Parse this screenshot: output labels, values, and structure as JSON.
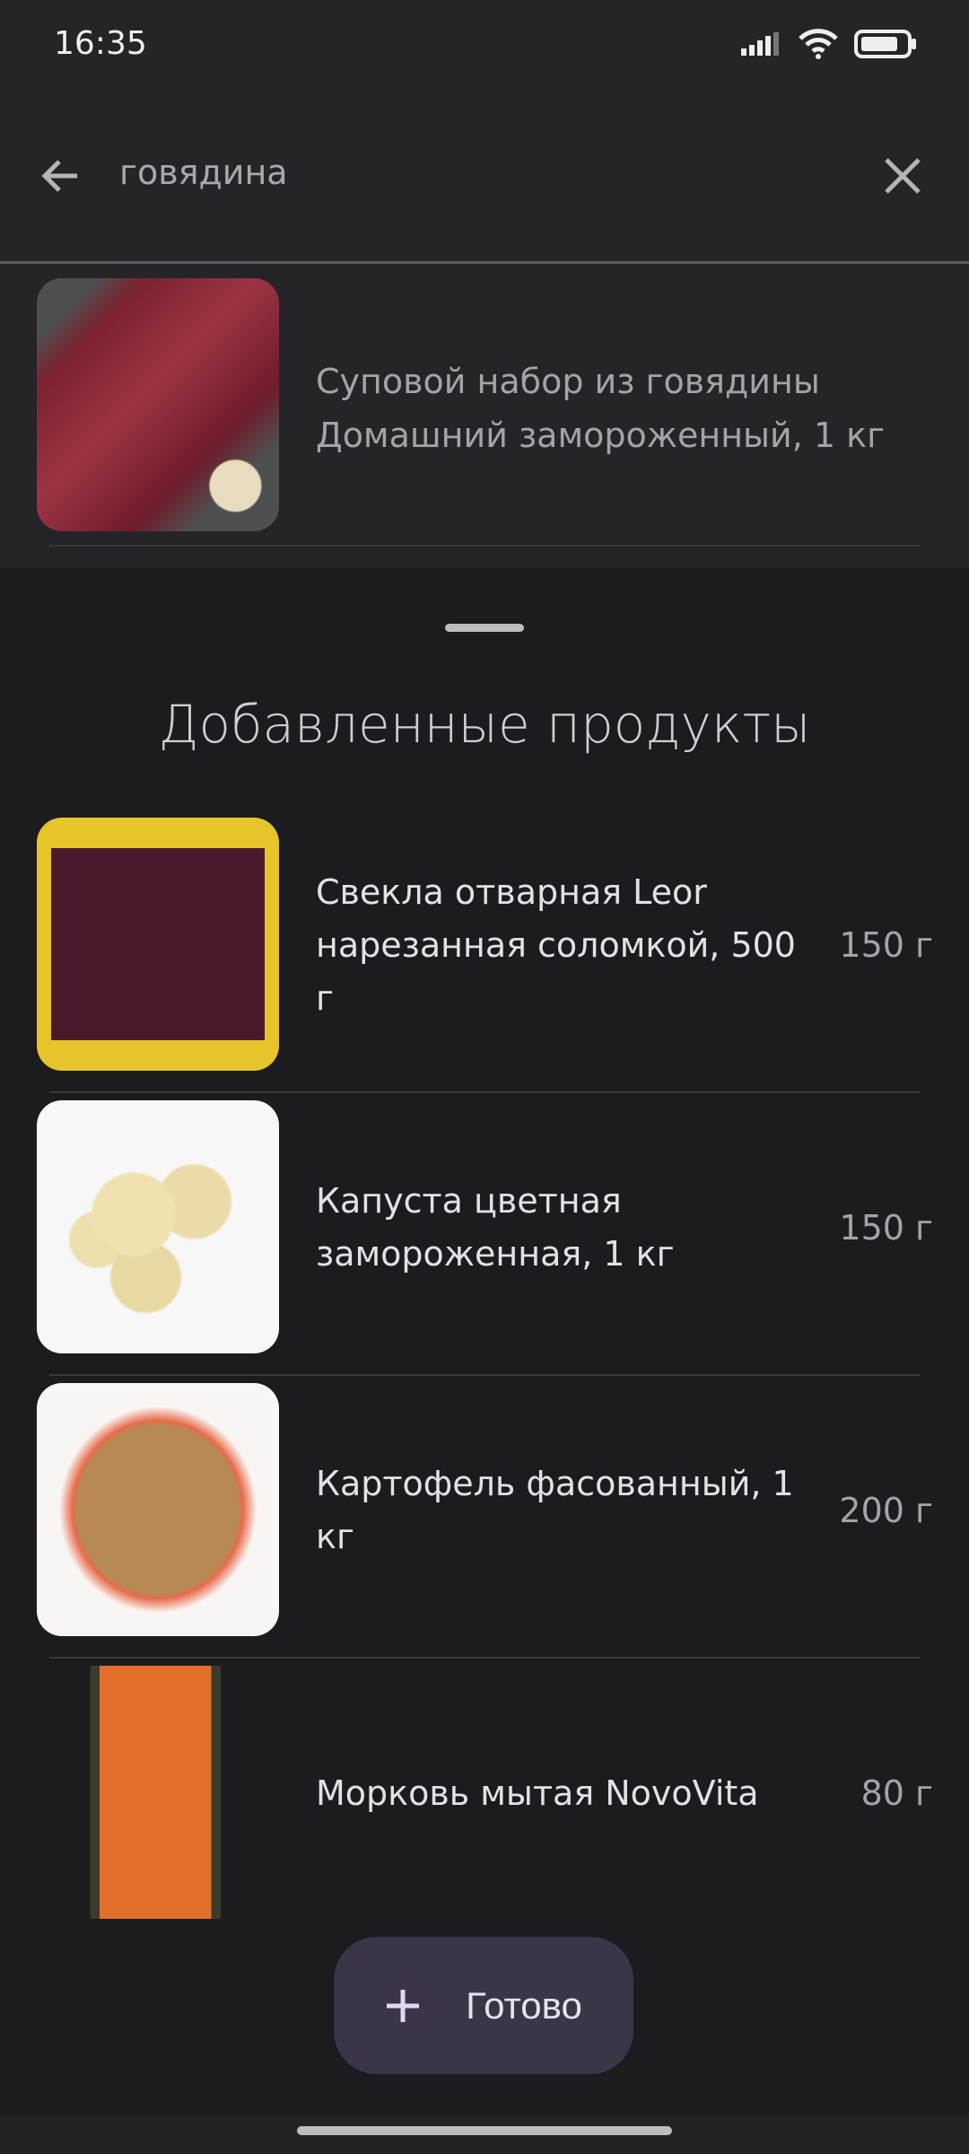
{
  "status_bar": {
    "time": "16:35",
    "icons": [
      "signal-icon",
      "wifi-icon",
      "battery-icon"
    ]
  },
  "search": {
    "query": "говядина",
    "back_icon": "arrow-left-icon",
    "clear_icon": "close-icon"
  },
  "search_results": [
    {
      "line1": "Суповой набор из говядины",
      "line2": "Домашний замороженный, 1 кг"
    }
  ],
  "sheet": {
    "title": "Добавленные продукты",
    "items": [
      {
        "name": "Свекла отварная Leor нарезанная соломкой, 500 г",
        "qty": "150 г"
      },
      {
        "name": "Капуста цветная замороженная, 1 кг",
        "qty": "150 г"
      },
      {
        "name": "Картофель фасованный, 1 кг",
        "qty": "200 г"
      },
      {
        "name": "Морковь мытая NovoVita",
        "qty": "80 г"
      }
    ],
    "done_label": "Готово",
    "done_icon": "plus-icon"
  },
  "colors": {
    "accent_button": "#3b3547",
    "sheet_bg": "#1c1b20",
    "page_bg": "#252429"
  }
}
